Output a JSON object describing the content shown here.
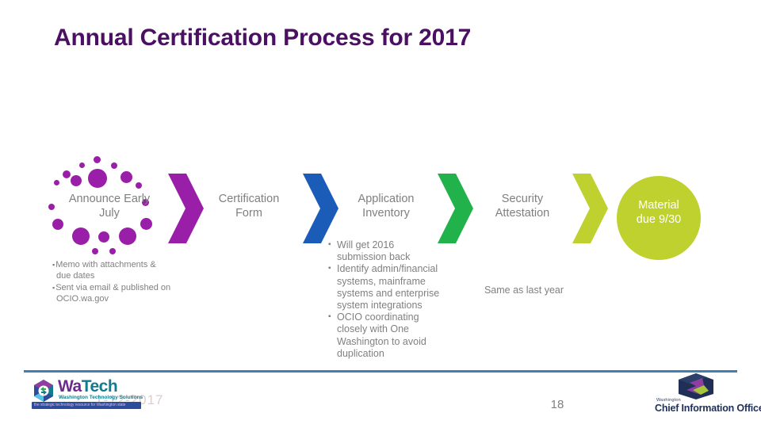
{
  "slide": {
    "title": "Annual Certification Process for 2017",
    "page_number": "18",
    "faint_overlay_text": "1-12-2017",
    "title_color": "#4B1062",
    "rule_color": "#3E7FB5"
  },
  "process": {
    "stages": [
      {
        "label": "Announce Early\nJuly",
        "label_line1": "Announce Early",
        "label_line2": "July",
        "shape": "dot-cluster",
        "color": "#9A1FA8",
        "text_color": "#7F7F7F"
      },
      {
        "label_line1": "Certification",
        "label_line2": "Form",
        "shape": "text-only",
        "color": "#1B5CB8",
        "text_color": "#7F7F7F"
      },
      {
        "label_line1": "Application",
        "label_line2": "Inventory",
        "shape": "text-only",
        "color": "#22B24C",
        "text_color": "#7F7F7F"
      },
      {
        "label_line1": "Security",
        "label_line2": "Attestation",
        "shape": "text-only",
        "color": "#BFD12F",
        "text_color": "#7F7F7F"
      },
      {
        "label_line1": "Material",
        "label_line2": "due 9/30",
        "shape": "circle",
        "color": "#BFD12F",
        "text_color": "#FFFFFF"
      }
    ],
    "connectors": [
      {
        "name": "chevron-1",
        "color": "#9A1FA8"
      },
      {
        "name": "chevron-2",
        "color": "#1B5CB8"
      },
      {
        "name": "chevron-3",
        "color": "#22B24C"
      },
      {
        "name": "chevron-4",
        "color": "#BFD12F"
      }
    ]
  },
  "columns": {
    "announce": {
      "bullets": [
        "Memo with attachments & due dates",
        "Sent via email & published on OCIO.wa.gov"
      ]
    },
    "certification_form": {
      "bullets": []
    },
    "application_inventory": {
      "bullets": [
        "Will get 2016 submission back",
        "Identify admin/financial systems, mainframe systems  and enterprise system integrations",
        "OCIO coordinating closely with One Washington to avoid duplication"
      ]
    },
    "security_attestation": {
      "note": "Same as last year"
    }
  },
  "footer": {
    "watech": {
      "word_1": "Wa",
      "word_2": "Tech",
      "subtitle": "Washington Technology Solutions",
      "banner": "the strategic technology resource for Washington state"
    },
    "cio": {
      "small_label": "Washington",
      "title": "Chief Information Officer"
    }
  }
}
